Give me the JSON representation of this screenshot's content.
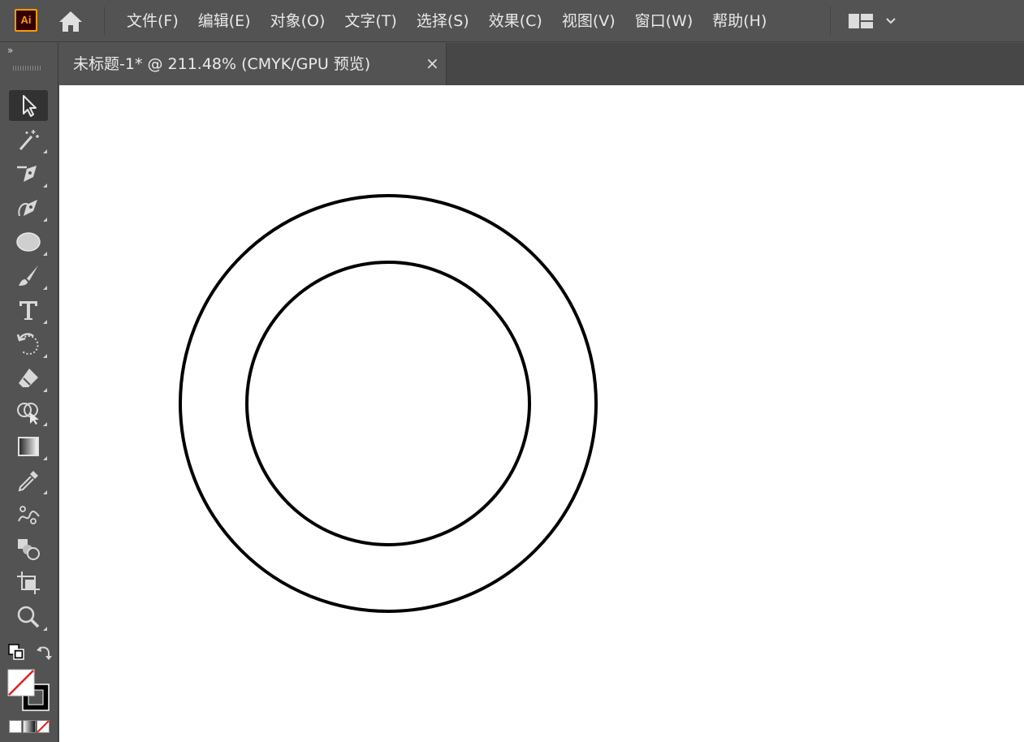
{
  "app": {
    "logo_text": "Ai",
    "logo_color": "#ff9a00"
  },
  "menu": {
    "items": [
      {
        "label": "文件(F)"
      },
      {
        "label": "编辑(E)"
      },
      {
        "label": "对象(O)"
      },
      {
        "label": "文字(T)"
      },
      {
        "label": "选择(S)"
      },
      {
        "label": "效果(C)"
      },
      {
        "label": "视图(V)"
      },
      {
        "label": "窗口(W)"
      },
      {
        "label": "帮助(H)"
      }
    ],
    "home_icon": "home-icon",
    "workspace_icon": "workspace-layout-icon",
    "workspace_dropdown_icon": "chevron-down-icon"
  },
  "document_tab": {
    "title": "未标题-1*  @  211.48% (CMYK/GPU 预览)",
    "close_symbol": "×"
  },
  "toolbar": {
    "collapse_symbol": "»",
    "tools": [
      {
        "name": "selection-tool",
        "icon": "arrow-pointer-icon",
        "active": true
      },
      {
        "name": "magic-wand-tool",
        "icon": "magic-wand-icon",
        "active": false
      },
      {
        "name": "pen-tool",
        "icon": "pen-icon",
        "active": false
      },
      {
        "name": "curvature-tool",
        "icon": "curvature-pen-icon",
        "active": false
      },
      {
        "name": "ellipse-tool",
        "icon": "ellipse-icon",
        "active": false
      },
      {
        "name": "paintbrush-tool",
        "icon": "paintbrush-icon",
        "active": false
      },
      {
        "name": "type-tool",
        "icon": "type-icon",
        "active": false
      },
      {
        "name": "rotate-tool",
        "icon": "rotate-icon",
        "active": false
      },
      {
        "name": "eraser-tool",
        "icon": "eraser-icon",
        "active": false
      },
      {
        "name": "shape-builder-tool",
        "icon": "shape-builder-icon",
        "active": false
      },
      {
        "name": "gradient-tool",
        "icon": "gradient-icon",
        "active": false
      },
      {
        "name": "eyedropper-tool",
        "icon": "eyedropper-icon",
        "active": false
      },
      {
        "name": "puppet-warp-tool",
        "icon": "puppet-warp-icon",
        "active": false
      },
      {
        "name": "blend-tool",
        "icon": "blend-icon",
        "active": false
      },
      {
        "name": "artboard-tool",
        "icon": "artboard-icon",
        "active": false
      },
      {
        "name": "zoom-tool",
        "icon": "zoom-icon",
        "active": false
      }
    ],
    "fill": "none",
    "stroke": "#000000"
  },
  "colors": {
    "ui_background": "#535353",
    "toolbar_active": "#323232",
    "canvas": "#ffffff",
    "stroke": "#000000",
    "none_slash": "#e02020"
  },
  "artwork": {
    "shapes": [
      {
        "type": "circle",
        "name": "outer-circle",
        "stroke": "#000000",
        "fill": "none"
      },
      {
        "type": "circle",
        "name": "inner-circle",
        "stroke": "#000000",
        "fill": "none"
      }
    ]
  }
}
